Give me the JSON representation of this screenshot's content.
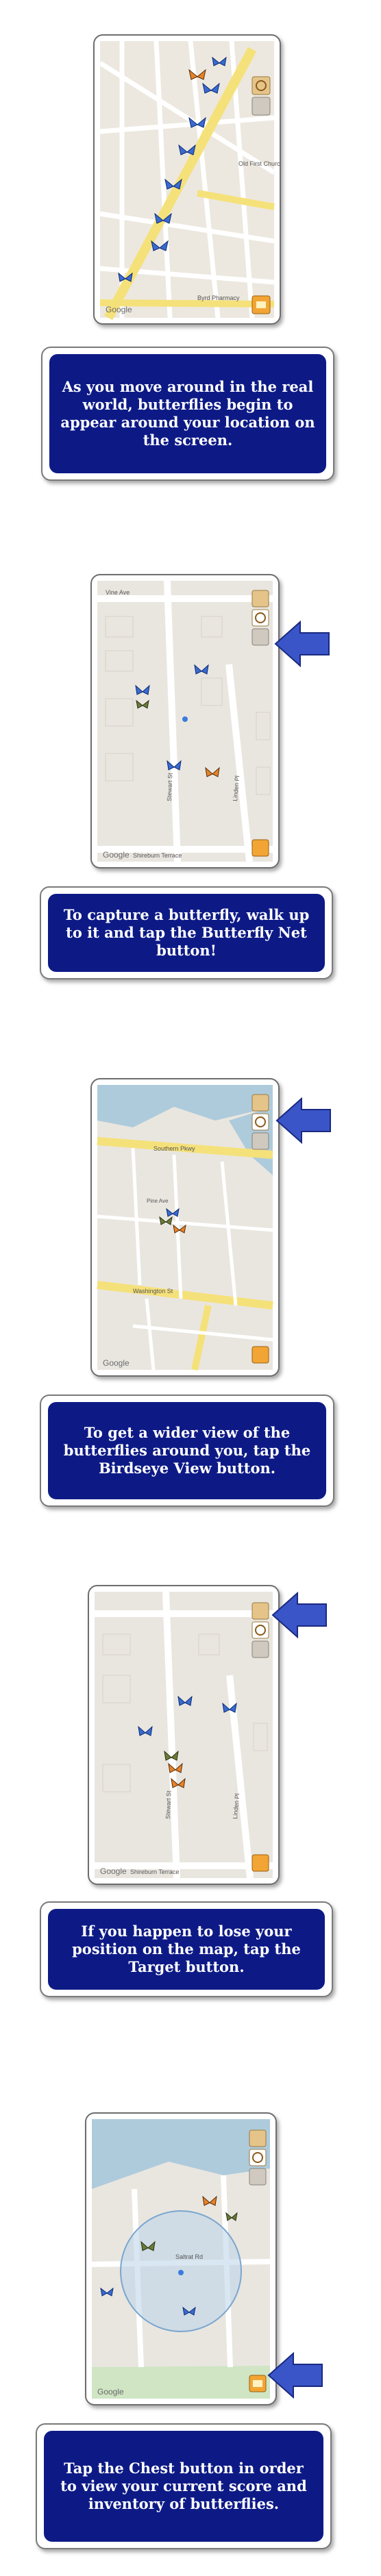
{
  "panels": [
    {
      "caption": "As you move around in the real world, butterflies begin to appear around your location on the screen."
    },
    {
      "caption": "To capture a butterfly, walk up to it and tap the Butterfly Net button!"
    },
    {
      "caption": "To get a wider view of the butterflies around you, tap the Birdseye View button."
    },
    {
      "caption": "If you happen to lose your position on the map, tap the Target button."
    },
    {
      "caption": "Tap the Chest button in order to view your current score and inventory of butterflies."
    }
  ],
  "map_labels": {
    "google": "Google",
    "p1": {
      "church": "Old First Church",
      "paulo": "Byrd Pharmacy"
    },
    "p2": {
      "vine": "Vine Ave",
      "stewart": "Stewart St",
      "linden": "Linden Pl",
      "terrace": "Shireburn Terrace"
    },
    "p3": {
      "southern": "Southern Pkwy",
      "washington": "Washington St",
      "pine": "Pine Ave"
    },
    "p4": {
      "stewart": "Stewart St",
      "linden": "Linden Pl",
      "terrace": "Shireburn Terrace"
    },
    "p5": {
      "saltrat": "Saltrat Rd"
    }
  },
  "colors": {
    "caption_bg": "#0d1a86",
    "caption_text": "#ffffff",
    "arrow": "#3a55c8",
    "map_land": "#e9e5dc",
    "road_yellow": "#f5e17a",
    "water": "#aecbdc"
  }
}
